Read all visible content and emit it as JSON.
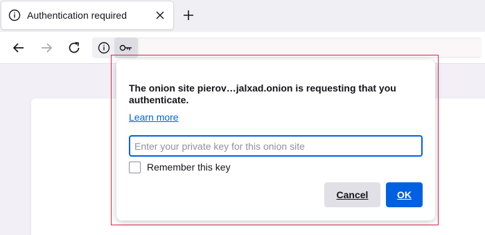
{
  "tab": {
    "title": "Authentication required"
  },
  "popup": {
    "message": "The onion site pierov…jalxad.onion is requesting that you authenticate.",
    "learn_more": "Learn more",
    "input_placeholder": "Enter your private key for this onion site",
    "input_value": "",
    "remember_label": "Remember this key",
    "remember_checked": false,
    "cancel_label": "Cancel",
    "ok_label": "OK"
  },
  "icons": {
    "tab": "info-icon",
    "tab_close": "close-icon",
    "new_tab": "plus-icon",
    "back": "arrow-left-icon",
    "forward": "arrow-right-icon",
    "reload": "reload-icon",
    "site_info": "info-icon",
    "key": "key-icon"
  },
  "colors": {
    "accent": "#0061e0",
    "highlight": "#e0234e"
  }
}
